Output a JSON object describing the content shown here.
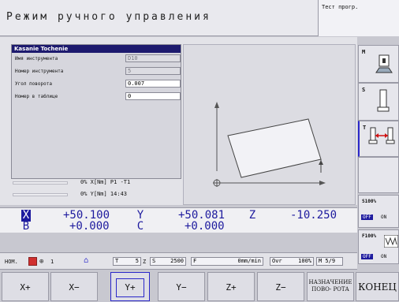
{
  "header": {
    "mode_title": "Режим ручного управления",
    "program_label": "Тест прогр."
  },
  "dialog": {
    "title": "Kasanie Tochenie",
    "fields": [
      {
        "label": "Имя инструмента",
        "value": "D10",
        "editable": false
      },
      {
        "label": "Номер инструмента",
        "value": "5",
        "editable": false
      },
      {
        "label": "Угол поворота",
        "value": "0.007",
        "editable": true
      },
      {
        "label": "Номер в таблице",
        "value": "0",
        "editable": true
      }
    ]
  },
  "status": {
    "line1": "0% X[Nm] P1  -T1",
    "line2": "0% Y[Nm] 14:43"
  },
  "positions": {
    "row1": [
      {
        "axis": "X",
        "value": "+50.100",
        "selected": true
      },
      {
        "axis": "Y",
        "value": "+50.081",
        "selected": false
      },
      {
        "axis": "Z",
        "value": "-10.250",
        "selected": false
      }
    ],
    "row2": [
      {
        "axis": "B",
        "value": "+0.000",
        "selected": false
      },
      {
        "axis": "C",
        "value": "+0.000",
        "selected": false
      }
    ]
  },
  "infobar": {
    "mode": "НОМ.",
    "home_num": "1",
    "t_label": "T",
    "t_value": "5",
    "z_label": "Z",
    "s_label": "S",
    "s_value": "2500",
    "f_label": "F",
    "f_value": "0mm/min",
    "ovr_label": "Ovr",
    "ovr_value": "100%",
    "m_value": "M 5/9"
  },
  "right_keys": {
    "m": "M",
    "s": "S",
    "t": "T",
    "s100": "S100%",
    "f100": "F100%",
    "off": "OFF",
    "on": "ON"
  },
  "softkeys": [
    {
      "label": "X+"
    },
    {
      "label": "X−"
    },
    {
      "label": "Y+"
    },
    {
      "label": "Y−"
    },
    {
      "label": "Z+"
    },
    {
      "label": "Z−"
    },
    {
      "label": "НАЗНАЧЕНИЕ ПОВО- РОТА"
    },
    {
      "label": "КОНЕЦ"
    }
  ]
}
